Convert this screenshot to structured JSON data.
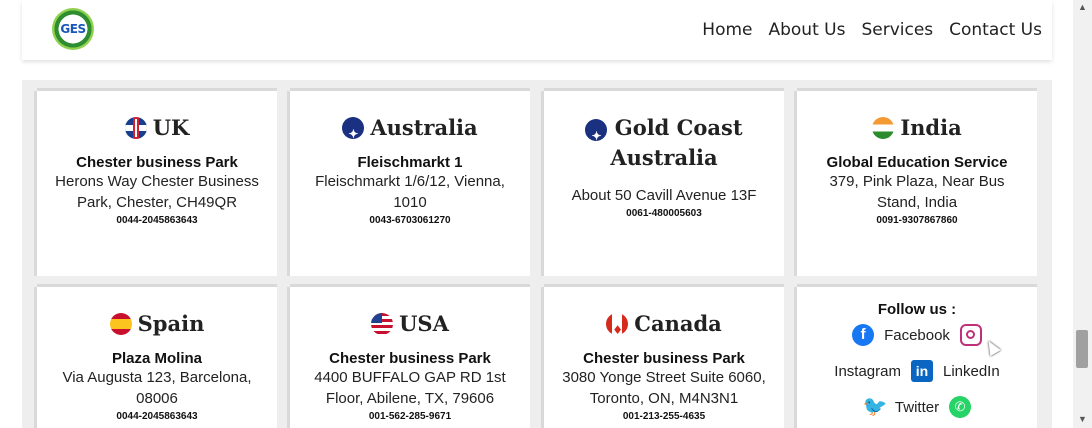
{
  "logo": {
    "text": "GES"
  },
  "nav": {
    "items": [
      "Home",
      "About Us",
      "Services",
      "Contact Us"
    ]
  },
  "offices": [
    {
      "country": "UK",
      "flag": "uk-flag-icon",
      "name": "Chester business Park",
      "address": "Herons Way Chester Business Park, Chester, CH49QR",
      "phone": "0044-2045863643"
    },
    {
      "country": "Australia",
      "flag": "australia-flag-icon",
      "name": "Fleischmarkt 1",
      "address": "Fleischmarkt 1/6/12, Vienna, 1010",
      "phone": "0043-6703061270"
    },
    {
      "country": "Gold Coast Australia",
      "flag": "australia-flag-icon",
      "name": "",
      "address": "About 50 Cavill Avenue 13F",
      "phone": "0061-480005603"
    },
    {
      "country": "India",
      "flag": "india-flag-icon",
      "name": "Global Education Service",
      "address": "379, Pink Plaza, Near Bus Stand, India",
      "phone": "0091-9307867860"
    },
    {
      "country": "Spain",
      "flag": "spain-flag-icon",
      "name": "Plaza Molina",
      "address": "Via Augusta 123, Barcelona, 08006",
      "phone": "0044-2045863643"
    },
    {
      "country": "USA",
      "flag": "usa-flag-icon",
      "name": "Chester business Park",
      "address": "4400 BUFFALO GAP RD 1st Floor, Abilene, TX, 79606",
      "phone": "001-562-285-9671"
    },
    {
      "country": "Canada",
      "flag": "canada-flag-icon",
      "name": "Chester business Park",
      "address": "3080 Yonge Street Suite 6060, Toronto, ON, M4N3N1",
      "phone": "001-213-255-4635"
    }
  ],
  "social": {
    "title": "Follow us :",
    "facebook": "Facebook",
    "instagram": "Instagram",
    "linkedin": "LinkedIn",
    "twitter": "Twitter"
  },
  "colors": {
    "facebook": "#1877f2",
    "instagram": "#c0307a",
    "linkedin": "#0a66c2",
    "twitter": "#1d9bf0",
    "whatsapp": "#25d366"
  }
}
